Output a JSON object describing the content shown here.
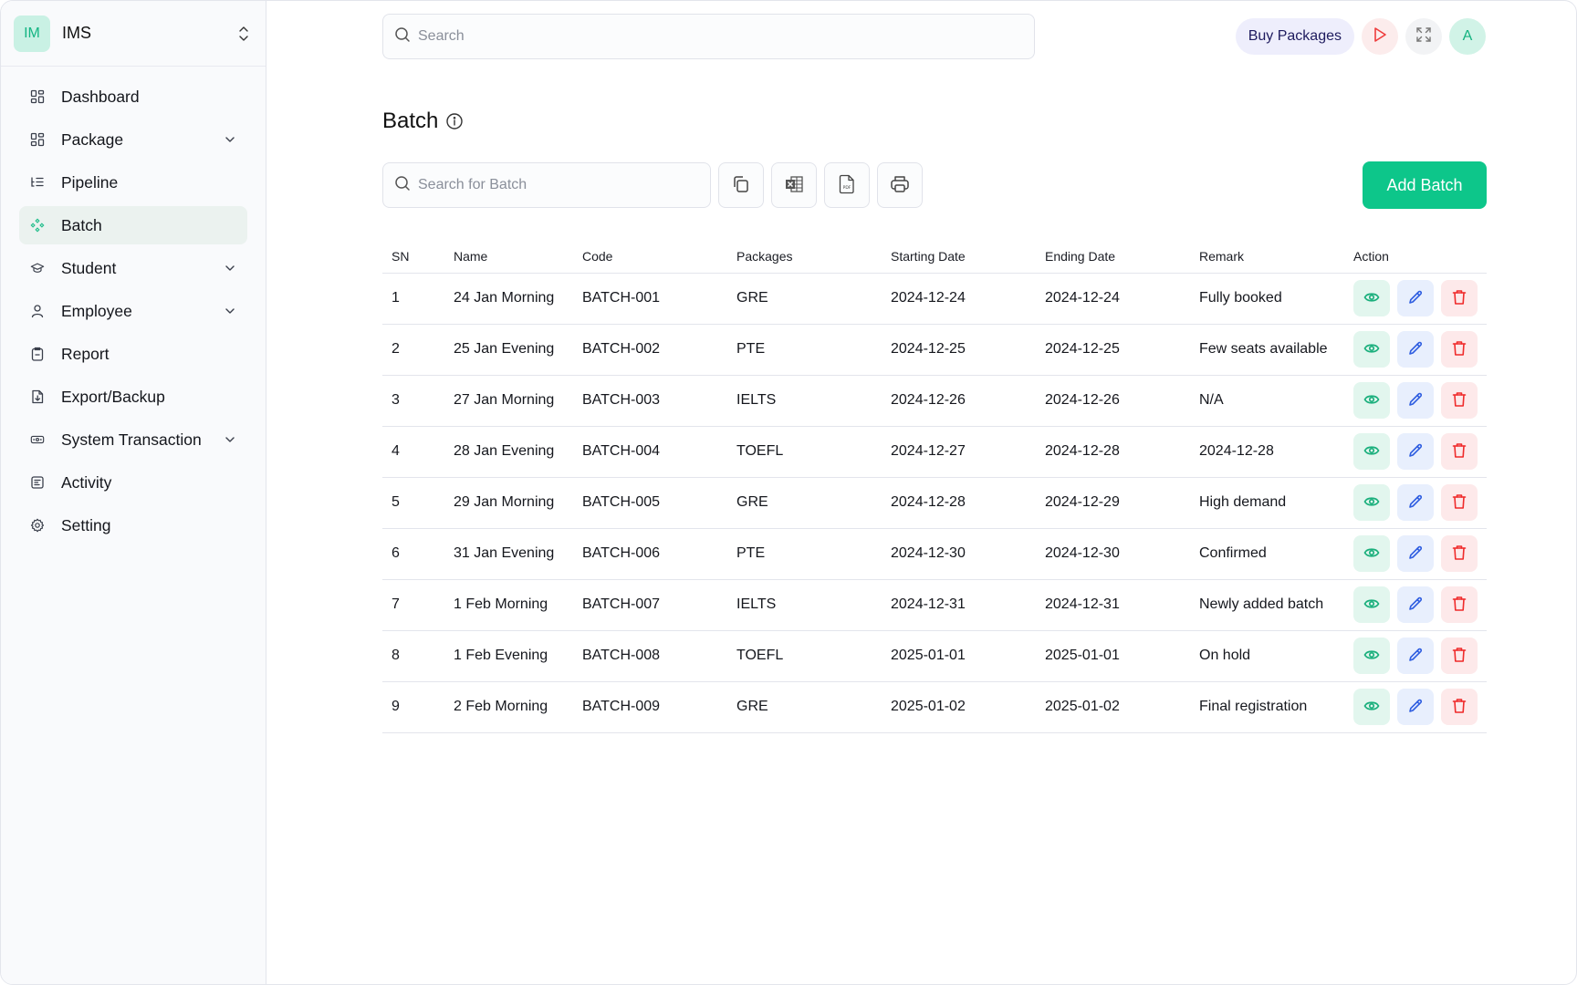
{
  "brand": {
    "logo_text": "IM",
    "name": "IMS"
  },
  "sidebar": {
    "items": [
      {
        "label": "Dashboard",
        "icon": "grid-icon",
        "has_chevron": false,
        "active": false
      },
      {
        "label": "Package",
        "icon": "grid-icon",
        "has_chevron": true,
        "active": false
      },
      {
        "label": "Pipeline",
        "icon": "list-tree-icon",
        "has_chevron": false,
        "active": false
      },
      {
        "label": "Batch",
        "icon": "nodes-icon",
        "has_chevron": false,
        "active": true
      },
      {
        "label": "Student",
        "icon": "graduation-cap-icon",
        "has_chevron": true,
        "active": false
      },
      {
        "label": "Employee",
        "icon": "user-icon",
        "has_chevron": true,
        "active": false
      },
      {
        "label": "Report",
        "icon": "clipboard-icon",
        "has_chevron": false,
        "active": false
      },
      {
        "label": "Export/Backup",
        "icon": "file-download-icon",
        "has_chevron": false,
        "active": false
      },
      {
        "label": "System Transaction",
        "icon": "banknote-icon",
        "has_chevron": true,
        "active": false
      },
      {
        "label": "Activity",
        "icon": "document-lines-icon",
        "has_chevron": false,
        "active": false
      },
      {
        "label": "Setting",
        "icon": "gear-icon",
        "has_chevron": false,
        "active": false
      }
    ]
  },
  "header": {
    "search_placeholder": "Search",
    "buy_packages_label": "Buy Packages",
    "avatar_initial": "A"
  },
  "page": {
    "title": "Batch",
    "search_placeholder": "Search for Batch",
    "add_button_label": "Add Batch",
    "toolbar_icons": [
      "copy-icon",
      "excel-icon",
      "pdf-icon",
      "print-icon"
    ]
  },
  "colors": {
    "accent": "#0dc68a",
    "view": "#1aaf7c",
    "edit": "#2f5ee0",
    "delete": "#ef2a2a"
  },
  "table": {
    "headers": [
      "SN",
      "Name",
      "Code",
      "Packages",
      "Starting Date",
      "Ending Date",
      "Remark",
      "Action"
    ],
    "rows": [
      {
        "sn": "1",
        "name": "24 Jan Morning",
        "code": "BATCH-001",
        "package": "GRE",
        "start": "2024-12-24",
        "end": "2024-12-24",
        "remark": "Fully booked"
      },
      {
        "sn": "2",
        "name": "25 Jan Evening",
        "code": "BATCH-002",
        "package": "PTE",
        "start": "2024-12-25",
        "end": "2024-12-25",
        "remark": "Few seats available"
      },
      {
        "sn": "3",
        "name": "27 Jan Morning",
        "code": "BATCH-003",
        "package": "IELTS",
        "start": "2024-12-26",
        "end": "2024-12-26",
        "remark": "N/A"
      },
      {
        "sn": "4",
        "name": "28 Jan Evening",
        "code": "BATCH-004",
        "package": "TOEFL",
        "start": "2024-12-27",
        "end": "2024-12-28",
        "remark": "2024-12-28"
      },
      {
        "sn": "5",
        "name": "29 Jan Morning",
        "code": "BATCH-005",
        "package": "GRE",
        "start": "2024-12-28",
        "end": "2024-12-29",
        "remark": "High demand"
      },
      {
        "sn": "6",
        "name": "31 Jan Evening",
        "code": "BATCH-006",
        "package": "PTE",
        "start": "2024-12-30",
        "end": "2024-12-30",
        "remark": "Confirmed"
      },
      {
        "sn": "7",
        "name": "1 Feb Morning",
        "code": "BATCH-007",
        "package": "IELTS",
        "start": "2024-12-31",
        "end": "2024-12-31",
        "remark": "Newly added batch"
      },
      {
        "sn": "8",
        "name": "1 Feb Evening",
        "code": "BATCH-008",
        "package": "TOEFL",
        "start": "2025-01-01",
        "end": "2025-01-01",
        "remark": "On hold"
      },
      {
        "sn": "9",
        "name": "2 Feb Morning",
        "code": "BATCH-009",
        "package": "GRE",
        "start": "2025-01-02",
        "end": "2025-01-02",
        "remark": "Final registration"
      }
    ]
  }
}
